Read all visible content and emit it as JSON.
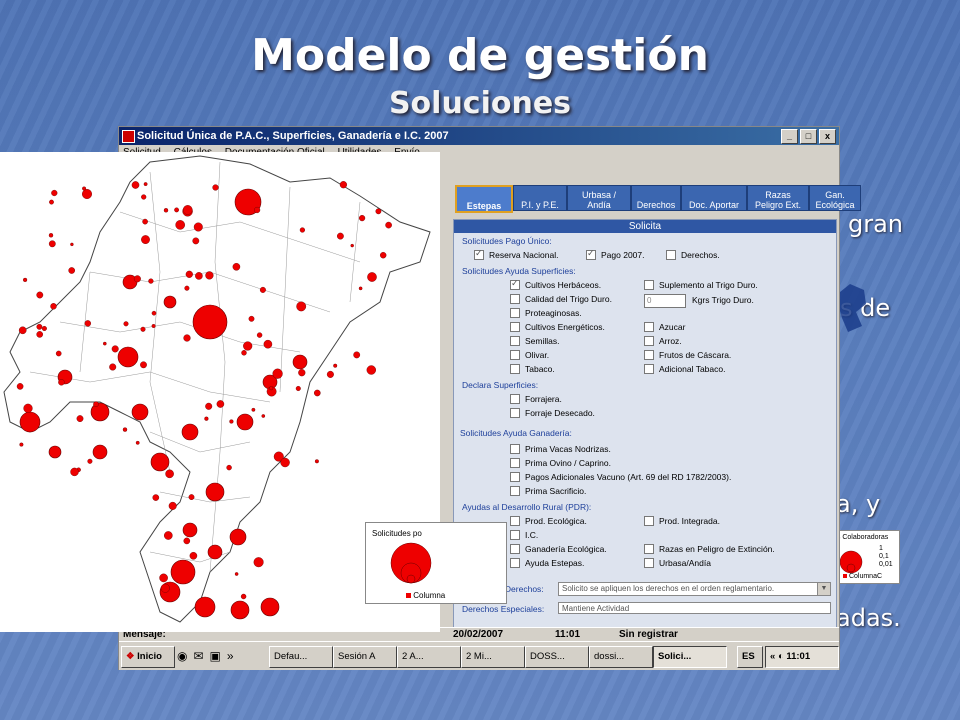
{
  "slide": {
    "title": "Modelo de gestión",
    "subtitle": "Soluciones",
    "fragments": [
      "gran",
      "s de",
      "a, y",
      "adas."
    ]
  },
  "window": {
    "title": "Solicitud Única de P.A.C., Superficies, Ganadería e I.C. 2007",
    "buttons": [
      "_",
      "□",
      "x"
    ],
    "menu": [
      "Solicitud",
      "Cálculos",
      "Documentación Oficial",
      "Utilidades",
      "Envío"
    ]
  },
  "tabs": [
    {
      "label": "Estepas",
      "active": true
    },
    {
      "label": "P.I. y P.E.",
      "active": false
    },
    {
      "label": "Urbasa /\nAndía",
      "active": false
    },
    {
      "label": "Derechos",
      "active": false
    },
    {
      "label": "Doc. Aportar",
      "active": false
    },
    {
      "label": "Razas\nPeligro Ext.",
      "active": false
    },
    {
      "label": "Gan.\nEcológica",
      "active": false
    }
  ],
  "panel": {
    "header": "Solicita",
    "sections": {
      "pago_unico": "Solicitudes Pago Único:",
      "ayuda_superficies": "Solicitudes Ayuda Superficies:",
      "declara_superficies": "Declara Superficies:",
      "ayuda_ganaderia": "Solicitudes Ayuda Ganadería:",
      "desarrollo_rural": "Ayudas al Desarrollo Rural (PDR):"
    },
    "pago_unico": [
      {
        "label": "Reserva Nacional.",
        "checked": true
      },
      {
        "label": "Pago 2007.",
        "checked": true
      },
      {
        "label": "Derechos.",
        "checked": false
      }
    ],
    "superficies_left": [
      {
        "label": "Cultivos Herbáceos.",
        "checked": true
      },
      {
        "label": "Calidad del Trigo Duro.",
        "checked": false
      },
      {
        "label": "Proteaginosas.",
        "checked": false
      },
      {
        "label": "Cultivos Energéticos.",
        "checked": false
      },
      {
        "label": "Semillas.",
        "checked": false
      },
      {
        "label": "Olivar.",
        "checked": false
      },
      {
        "label": "Tabaco.",
        "checked": false
      }
    ],
    "superficies_right": [
      {
        "label": "Suplemento al Trigo Duro.",
        "checked": false
      },
      {
        "label": "Azucar",
        "checked": false
      },
      {
        "label": "Arroz.",
        "checked": false
      },
      {
        "label": "Frutos de Cáscara.",
        "checked": false
      },
      {
        "label": "Adicional Tabaco.",
        "checked": false
      }
    ],
    "kgrs_value": "0",
    "kgrs_label": "Kgrs Trigo Duro.",
    "declara": [
      {
        "label": "Forrajera.",
        "checked": false
      },
      {
        "label": "Forraje Desecado.",
        "checked": false
      }
    ],
    "ganaderia": [
      {
        "label": "Prima Vacas Nodrizas.",
        "checked": false
      },
      {
        "label": "Prima Ovino / Caprino.",
        "checked": false
      },
      {
        "label": "Pagos Adicionales Vacuno (Art. 69 del RD 1782/2003).",
        "checked": false
      },
      {
        "label": "Prima Sacrificio.",
        "checked": false
      }
    ],
    "pdr_left": [
      {
        "label": "Prod. Ecológica.",
        "checked": false
      },
      {
        "label": "I.C.",
        "checked": false
      },
      {
        "label": "Ganadería Ecológica.",
        "checked": false
      },
      {
        "label": "Ayuda Estepas.",
        "checked": false
      }
    ],
    "pdr_right": [
      {
        "label": "Prod. Integrada.",
        "checked": false
      },
      {
        "label": "Razas en Peligro de Extinción.",
        "checked": false
      },
      {
        "label": "Urbasa/Andía",
        "checked": false
      }
    ],
    "aplicacion_label": "Aplicación de Derechos:",
    "aplicacion_value": "Solicito se apliquen los derechos en el orden reglamentario.",
    "especiales_label": "Derechos Especiales:",
    "especiales_value": "Mantiene Actividad"
  },
  "status": {
    "mensaje": "Mensaje:",
    "date": "20/02/2007",
    "time": "11:01",
    "state": "Sin registrar"
  },
  "taskbar": {
    "start": "Inicio",
    "items": [
      "Defau...",
      "Sesión A",
      "2 A...",
      "2 Mi...",
      "DOSS...",
      "dossi...",
      "Solici..."
    ],
    "lang": "ES",
    "clock": "11:01"
  },
  "map": {
    "legend_title": "Solicitudes po",
    "legend_item": "Columna"
  },
  "inset": {
    "title": "es Colaboradoras",
    "values": [
      "1",
      "0,1",
      "0,01"
    ],
    "legend": "ColumnaC"
  },
  "colors": {
    "accent": "#2f57a4",
    "bubble": "#ee0000",
    "slide_bg": "#5a7fbf"
  }
}
